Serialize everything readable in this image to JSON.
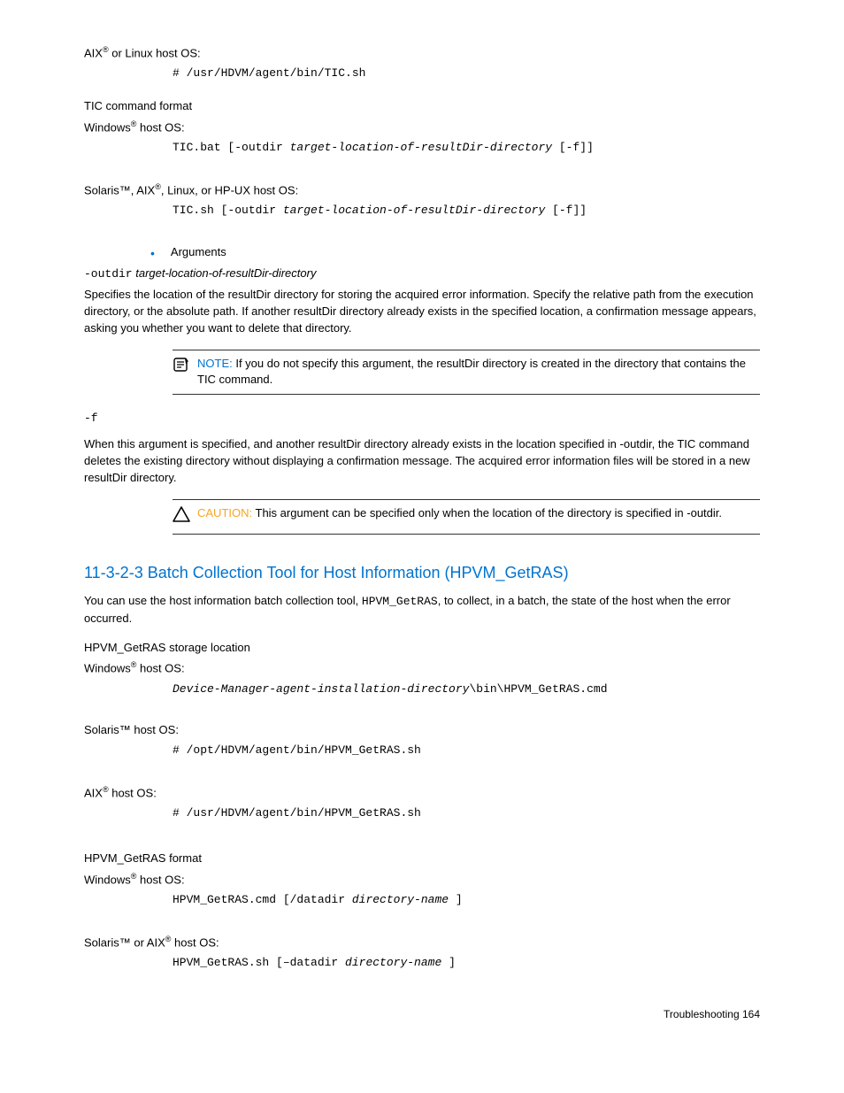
{
  "top": {
    "aix_linux": {
      "pre": "AIX",
      "sup": "®",
      "post": " or Linux host OS:"
    },
    "aix_linux_cmd": "# /usr/HDVM/agent/bin/TIC.sh"
  },
  "tic_format": {
    "heading": "TIC command format",
    "win": {
      "pre": "Windows",
      "sup": "®",
      "post": " host OS:"
    },
    "win_cmd1": "TIC.bat [-outdir ",
    "win_cmd2": "target-location-of-resultDir-directory",
    "win_cmd3": " [-f]]",
    "sol": {
      "pre1": "Solaris™, AIX",
      "sup": "®",
      "post": ", Linux, or HP-UX host OS:"
    },
    "sol_cmd1": "TIC.sh [-outdir ",
    "sol_cmd2": "target-location-of-resultDir-directory",
    "sol_cmd3": " [-f]]"
  },
  "args": {
    "heading": "Arguments",
    "outdir_flag": "-outdir",
    "outdir_var": " target-location-of-resultDir-directory",
    "outdir_desc": "Specifies the location of the resultDir directory for storing the acquired error information. Specify the relative path from the execution directory, or the absolute path. If another resultDir directory already exists in the specified location, a confirmation message appears, asking you whether you want to delete that directory.",
    "note_label": "NOTE:  ",
    "note_body": "If you do not specify this argument, the resultDir directory is created in the directory that contains the TIC command.",
    "f_flag": "-f",
    "f_desc": "When this argument is specified, and another resultDir directory already exists in the location specified in -outdir, the TIC command deletes the existing directory without displaying a confirmation message. The acquired error information files will be stored in a new resultDir directory.",
    "caution_label": "CAUTION:  ",
    "caution_body": "This argument can be specified only when the location of the directory is specified in -outdir."
  },
  "sec": {
    "heading": "11-3-2-3 Batch Collection Tool for Host Information (HPVM_GetRAS)",
    "intro1": "You can use the host information batch collection tool, ",
    "intro_code": "HPVM_GetRAS",
    "intro2": ", to collect, in a batch, the state of the host when the error occurred.",
    "storage_heading": "HPVM_GetRAS storage location",
    "win": {
      "pre": "Windows",
      "sup": "®",
      "post": " host OS:"
    },
    "win_cmd1": "Device-Manager-agent-installation-directory",
    "win_cmd2": "\\bin\\HPVM_GetRAS.cmd",
    "sol_label": "Solaris™ host OS:",
    "sol_cmd": "# /opt/HDVM/agent/bin/HPVM_GetRAS.sh",
    "aix": {
      "pre": "AIX",
      "sup": "®",
      "post": " host OS:"
    },
    "aix_cmd": "# /usr/HDVM/agent/bin/HPVM_GetRAS.sh",
    "format_heading": "HPVM_GetRAS format",
    "fwin": {
      "pre": "Windows",
      "sup": "®",
      "post": " host OS:"
    },
    "fwin_cmd1": "HPVM_GetRAS.cmd [/datadir ",
    "fwin_cmd2": "directory-name",
    "fwin_cmd3": " ]",
    "fsol": {
      "pre1": "Solaris™ or AIX",
      "sup": "®",
      "post": " host OS:"
    },
    "fsol_cmd1": "HPVM_GetRAS.sh [–datadir ",
    "fsol_cmd2": "directory-name",
    "fsol_cmd3": " ]"
  },
  "footer": "Troubleshooting  164"
}
